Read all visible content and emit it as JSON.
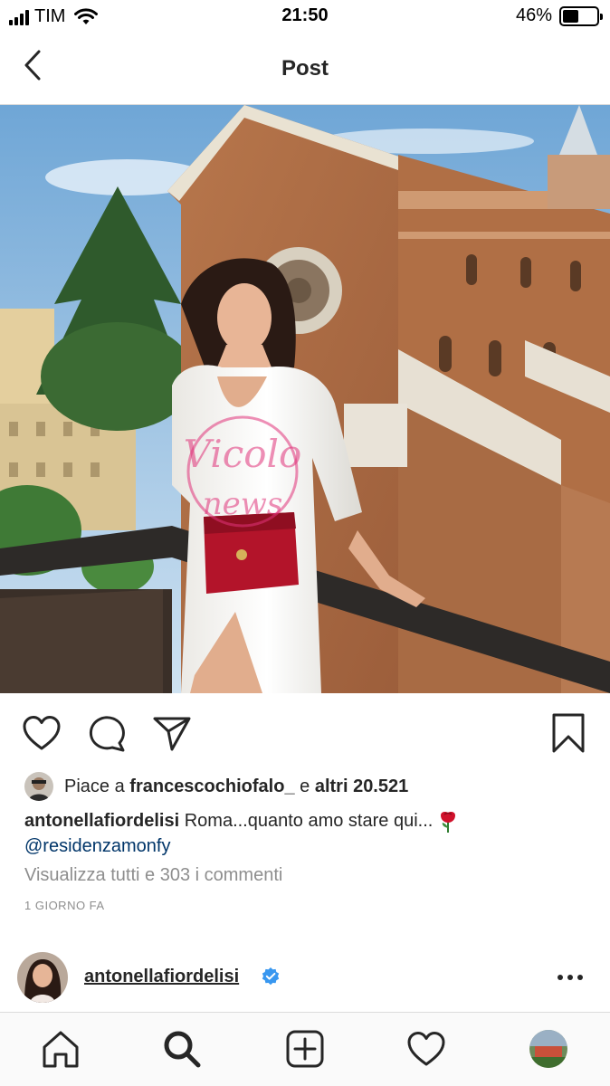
{
  "status_bar": {
    "carrier": "TIM",
    "time": "21:50",
    "battery_percent": "46%",
    "battery_level": 0.46,
    "icons": [
      "signal-bars-icon",
      "wifi-icon",
      "battery-icon"
    ]
  },
  "nav": {
    "title": "Post",
    "back_icon": "chevron-left-icon"
  },
  "post": {
    "image_description_icon": "post-photo",
    "watermark": {
      "line1": "Vicolo",
      "line2": "news"
    },
    "actions": {
      "like_icon": "heart-icon",
      "comment_icon": "comment-bubble-icon",
      "share_icon": "paper-plane-icon",
      "save_icon": "bookmark-icon"
    },
    "likes": {
      "prefix": "Piace a",
      "user": "francescochiofalo_",
      "connector": "e",
      "others": "altri 20.521"
    },
    "caption": {
      "username": "antonellafiordelisi",
      "text": "Roma...quanto amo stare qui...",
      "mention": "@residenzamonfy"
    },
    "view_comments": "Visualizza tutti e 303 i commenti",
    "time_ago": "1 GIORNO FA"
  },
  "next_post": {
    "username": "antonellafiordelisi",
    "verified": true,
    "more_icon": "more-horizontal-icon"
  },
  "tab_bar": {
    "items": [
      "home-icon",
      "search-icon",
      "new-post-icon",
      "activity-heart-icon",
      "profile-avatar"
    ]
  },
  "colors": {
    "text": "#262626",
    "secondary": "#8e8e8e",
    "mention": "#003569",
    "verified": "#3897f0",
    "divider": "#dbdbdb"
  }
}
